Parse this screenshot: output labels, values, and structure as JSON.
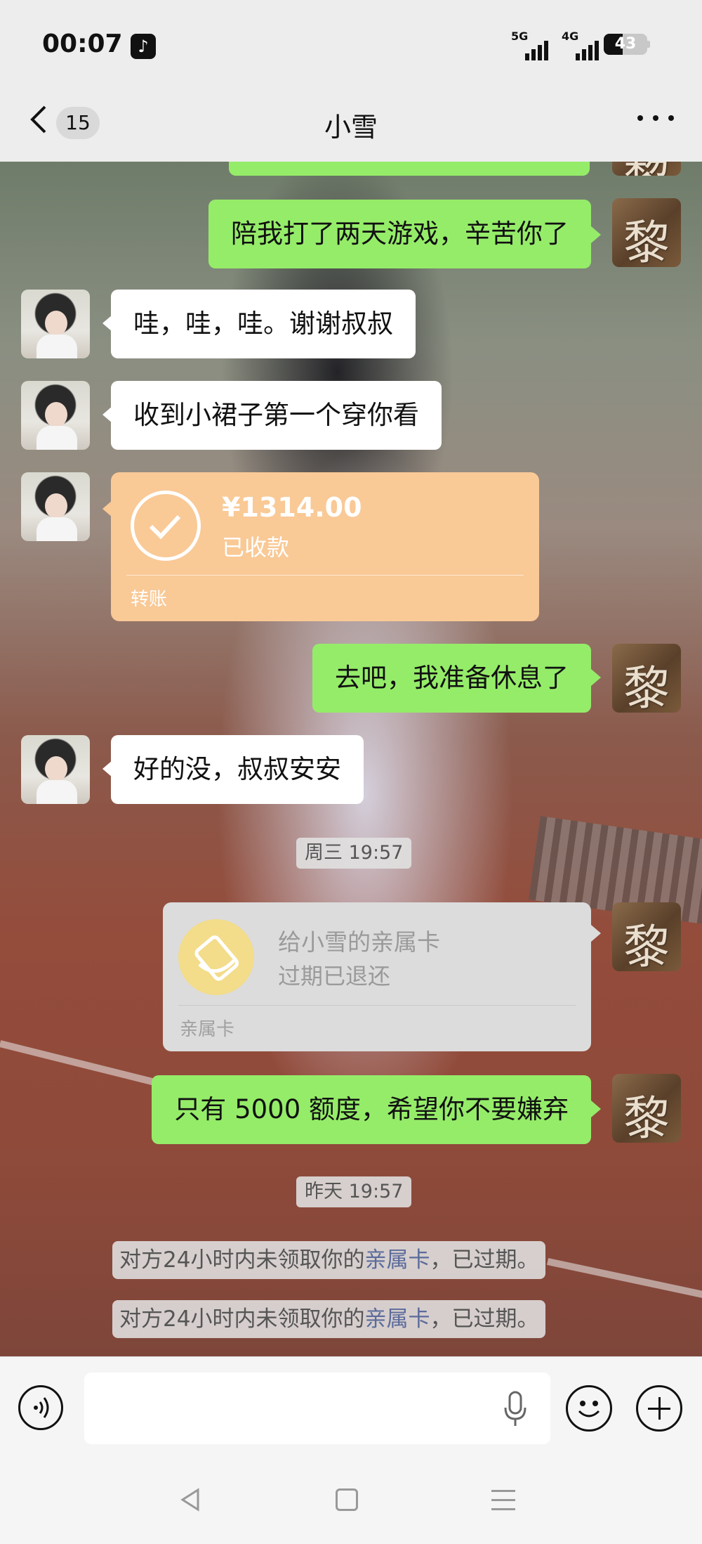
{
  "status_bar": {
    "time": "00:07",
    "app_icon": "tiktok-icon",
    "signal_1": "5G",
    "signal_2": "4G",
    "battery_level": "43"
  },
  "header": {
    "back_icon": "chevron-left-icon",
    "unread_count": "15",
    "title": "小雪",
    "more_icon": "more-dots-icon"
  },
  "messages": [
    {
      "from": "me",
      "text": "陪我打了两天游戏，辛苦你了"
    },
    {
      "from": "her",
      "text": "哇，哇，哇。谢谢叔叔"
    },
    {
      "from": "her",
      "text": "收到小裙子第一个穿你看"
    },
    {
      "from": "her",
      "type": "transfer",
      "amount": "¥1314.00",
      "status": "已收款",
      "label": "转账"
    },
    {
      "from": "me",
      "text": "去吧，我准备休息了"
    },
    {
      "from": "her",
      "text": "好的没，叔叔安安"
    },
    {
      "type": "timestamp",
      "text": "周三 19:57"
    },
    {
      "from": "me",
      "type": "family_card",
      "title": "给小雪的亲属卡",
      "status": "过期已退还",
      "label": "亲属卡"
    },
    {
      "from": "me",
      "text": "只有 5000 额度，希望你不要嫌弃"
    },
    {
      "type": "timestamp",
      "text": "昨天 19:57"
    },
    {
      "type": "system",
      "prefix": "对方24小时内未领取你的",
      "link": "亲属卡",
      "suffix": "，已过期。"
    },
    {
      "type": "system",
      "prefix": "对方24小时内未领取你的",
      "link": "亲属卡",
      "suffix": "，已过期。"
    }
  ],
  "avatars": {
    "me_glyph": "黎"
  },
  "input_bar": {
    "voice_icon": "voice-mode-icon",
    "input_placeholder": "",
    "mic_icon": "mic-icon",
    "emoji_icon": "emoji-icon",
    "plus_icon": "plus-icon"
  },
  "colors": {
    "my_bubble": "#95ec69",
    "her_bubble": "#ffffff",
    "transfer": "#f9c996",
    "link": "#5b6b9b"
  }
}
